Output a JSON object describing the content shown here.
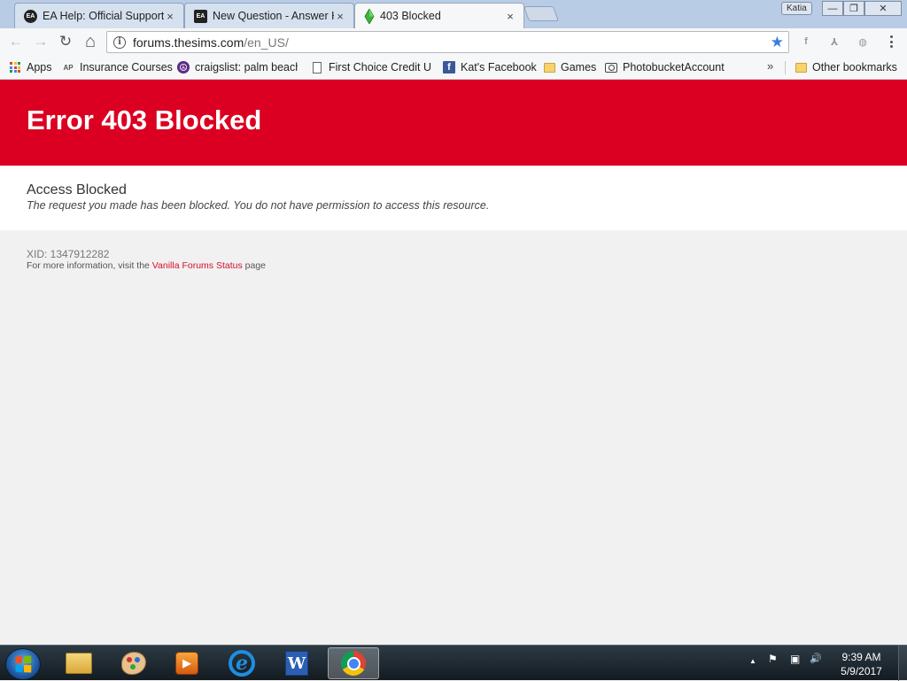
{
  "browser": {
    "user_badge": "Katia",
    "tabs": [
      {
        "favicon": "ea-logo-icon",
        "title": "EA Help: Official Support",
        "close": "×"
      },
      {
        "favicon": "ea-logo-icon",
        "title": "New Question - Answer HQ",
        "close": "×"
      },
      {
        "favicon": "sims-plumbob-icon",
        "title": "403 Blocked",
        "close": "×"
      }
    ],
    "favicon_ea_text": "EA",
    "window_controls": {
      "minimize": "—",
      "restore": "❐",
      "close": "✕"
    },
    "nav": {
      "back": "←",
      "forward": "→",
      "reload": "↻",
      "home": "⌂"
    },
    "omnibox": {
      "domain": "forums.thesims.com",
      "path": "/en_US/",
      "info_glyph": "i",
      "star": "★"
    },
    "extensions": [
      "f",
      "⅄",
      "◍"
    ]
  },
  "bookmarks": {
    "items": [
      {
        "icon": "apps-grid-icon",
        "label": "Apps"
      },
      {
        "icon": "ap-icon",
        "label": "Insurance Courses"
      },
      {
        "icon": "peace-icon",
        "label": "craigslist: palm beach"
      },
      {
        "icon": "page-icon",
        "label": "First Choice Credit Un"
      },
      {
        "icon": "facebook-icon",
        "label": "Kat's Facebook"
      },
      {
        "icon": "folder-icon",
        "label": "Games"
      },
      {
        "icon": "camera-icon",
        "label": "PhotobucketAccount"
      }
    ],
    "overflow": "»",
    "other": {
      "icon": "folder-icon",
      "label": "Other bookmarks"
    },
    "ap_text": "AP",
    "peace_glyph": "☮",
    "fb_glyph": "f"
  },
  "page": {
    "banner_title": "Error 403 Blocked",
    "message_title": "Access Blocked",
    "message_desc": "The request you made has been blocked. You do not have permission to access this resource.",
    "xid": "XID: 1347912282",
    "more_info_prefix": "For more information, visit the ",
    "more_info_link": "Vanilla Forums Status",
    "more_info_suffix": " page",
    "colors": {
      "banner": "#db0021",
      "link": "#d4102b"
    }
  },
  "taskbar": {
    "apps": [
      "folder-icon",
      "paint-icon",
      "media-player-icon",
      "internet-explorer-icon",
      "word-icon",
      "chrome-icon"
    ],
    "ie_glyph": "e",
    "word_glyph": "W",
    "media_glyph": "▶",
    "tray": {
      "up_arrow": "▲",
      "flag": "⚑",
      "network": "▣",
      "volume": "🔊"
    },
    "time": "9:39 AM",
    "date": "5/9/2017"
  }
}
